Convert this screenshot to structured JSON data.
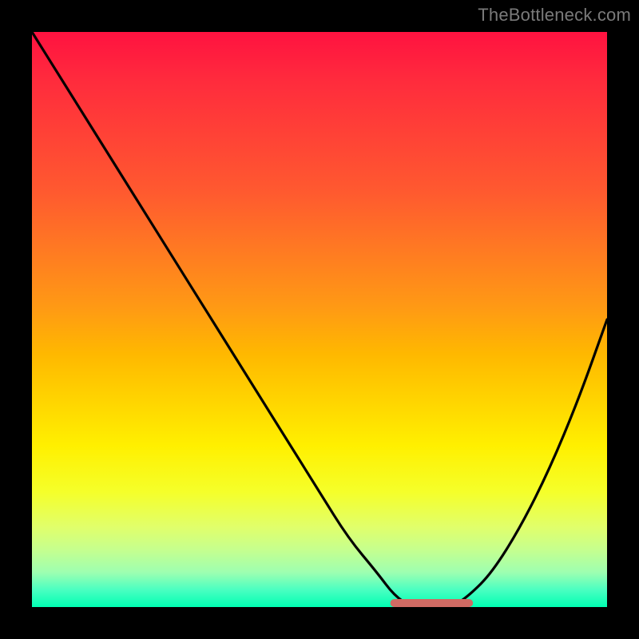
{
  "watermark": "TheBottleneck.com",
  "chart_data": {
    "type": "line",
    "title": "",
    "xlabel": "",
    "ylabel": "",
    "xlim": [
      0,
      100
    ],
    "ylim": [
      0,
      100
    ],
    "grid": false,
    "legend": false,
    "series": [
      {
        "name": "bottleneck-curve",
        "x": [
          0,
          5,
          10,
          15,
          20,
          25,
          30,
          35,
          40,
          45,
          50,
          55,
          60,
          63,
          66,
          70,
          73,
          76,
          80,
          85,
          90,
          95,
          100
        ],
        "values": [
          100,
          92,
          84,
          76,
          68,
          60,
          52,
          44,
          36,
          28,
          20,
          12,
          6,
          2,
          0,
          0,
          0,
          2,
          6,
          14,
          24,
          36,
          50
        ]
      }
    ],
    "annotations": [
      {
        "name": "optimal-floor",
        "x_start": 63,
        "x_end": 76,
        "y": 0
      }
    ],
    "background_gradient": {
      "top": "#ff1240",
      "mid1": "#ff9a14",
      "mid2": "#fff000",
      "bottom": "#00ffb3"
    }
  }
}
